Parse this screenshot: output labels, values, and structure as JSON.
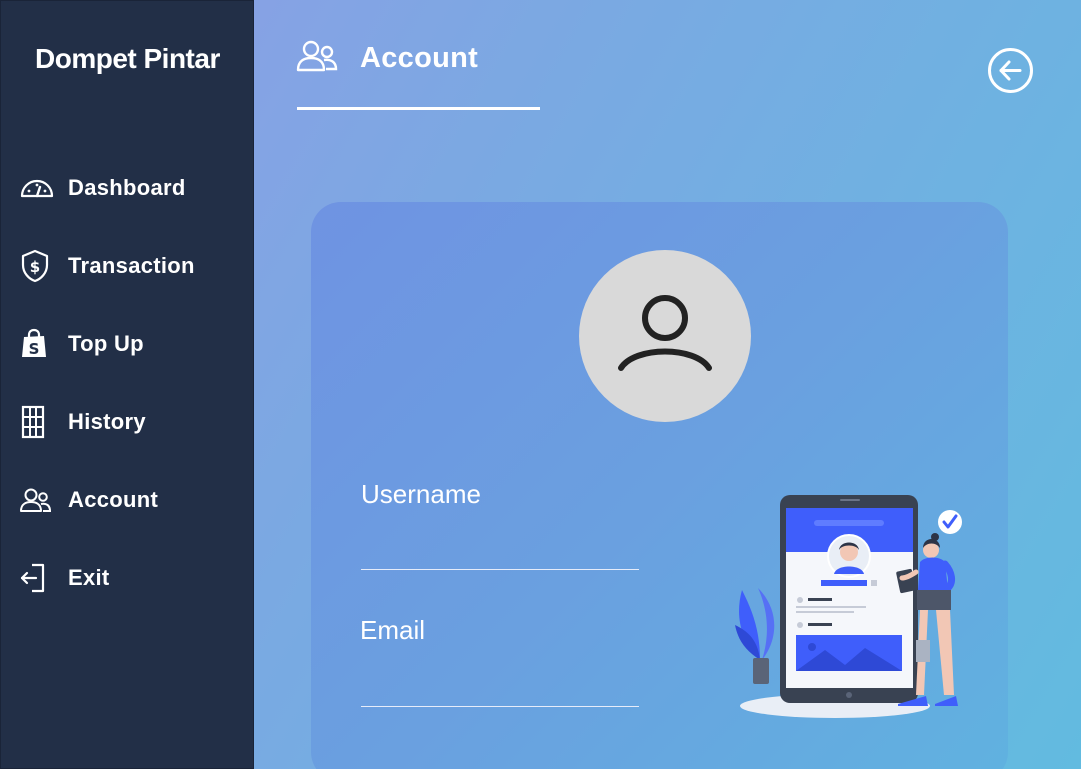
{
  "app": {
    "brand": "Dompet Pintar"
  },
  "sidebar": {
    "items": [
      {
        "label": "Dashboard",
        "icon": "gauge-icon"
      },
      {
        "label": "Transaction",
        "icon": "shield-dollar-icon"
      },
      {
        "label": "Top Up",
        "icon": "shopping-bag-icon"
      },
      {
        "label": "History",
        "icon": "ledger-icon"
      },
      {
        "label": "Account",
        "icon": "users-icon"
      },
      {
        "label": "Exit",
        "icon": "exit-icon"
      }
    ]
  },
  "header": {
    "title": "Account",
    "icon": "users-icon",
    "back_icon": "arrow-left-circle-icon"
  },
  "profile": {
    "avatar_icon": "user-icon",
    "username_label": "Username",
    "username_value": "",
    "email_label": "Email",
    "email_value": ""
  },
  "colors": {
    "sidebar": "#222f47",
    "gradient_start": "#8f9de6",
    "gradient_end": "#62bbe0",
    "avatar_bg": "#d9d9d9",
    "accent": "#3f5efb"
  }
}
